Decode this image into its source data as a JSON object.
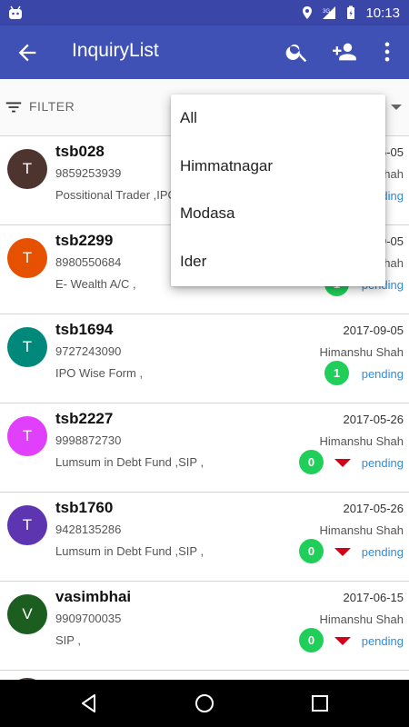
{
  "status_bar": {
    "time": "10:13",
    "network": "3G"
  },
  "app_bar": {
    "title": "InquiryList"
  },
  "filter": {
    "label": "FILTER"
  },
  "dropdown": {
    "options": [
      "All",
      "Himmatnagar",
      "Modasa",
      "Ider"
    ]
  },
  "items": [
    {
      "initial": "T",
      "avatar_color": "#4e342e",
      "name": "tsb028",
      "phone": "9859253939",
      "desc": "Possitional Trader ,IPO",
      "date": "2017-05-05",
      "person": "Himanshu Shah",
      "count": "",
      "status": "pending",
      "has_arrow": false
    },
    {
      "initial": "T",
      "avatar_color": "#e65100",
      "name": "tsb2299",
      "phone": "8980550684",
      "desc": "E- Wealth A/C ,",
      "date": "2017-09-05",
      "person": "Himanshu Shah",
      "count": "1",
      "status": "pending",
      "has_arrow": false
    },
    {
      "initial": "T",
      "avatar_color": "#00897b",
      "name": "tsb1694",
      "phone": "9727243090",
      "desc": "IPO Wise Form ,",
      "date": "2017-09-05",
      "person": "Himanshu Shah",
      "count": "1",
      "status": "pending",
      "has_arrow": false
    },
    {
      "initial": "T",
      "avatar_color": "#e040fb",
      "name": "tsb2227",
      "phone": "9998872730",
      "desc": "Lumsum in Debt Fund ,SIP ,",
      "date": "2017-05-26",
      "person": "Himanshu Shah",
      "count": "0",
      "status": "pending",
      "has_arrow": true
    },
    {
      "initial": "T",
      "avatar_color": "#5e35b1",
      "name": "tsb1760",
      "phone": "9428135286",
      "desc": "Lumsum in Debt Fund ,SIP ,",
      "date": "2017-05-26",
      "person": "Himanshu Shah",
      "count": "0",
      "status": "pending",
      "has_arrow": true
    },
    {
      "initial": "V",
      "avatar_color": "#1b5e20",
      "name": "vasimbhai",
      "phone": "9909700035",
      "desc": "SIP ,",
      "date": "2017-06-15",
      "person": "Himanshu Shah",
      "count": "0",
      "status": "pending",
      "has_arrow": true
    }
  ],
  "colors": {
    "primary": "#3f51b5",
    "status_bar": "#3a47a8",
    "badge": "#1fcf5a",
    "pending": "#2a8fe0",
    "arrow": "#d0021b"
  },
  "icons": {
    "back": "arrow-back-icon",
    "search": "search-icon",
    "add_person": "person-add-icon",
    "more": "more-vert-icon",
    "filter": "filter-list-icon"
  }
}
